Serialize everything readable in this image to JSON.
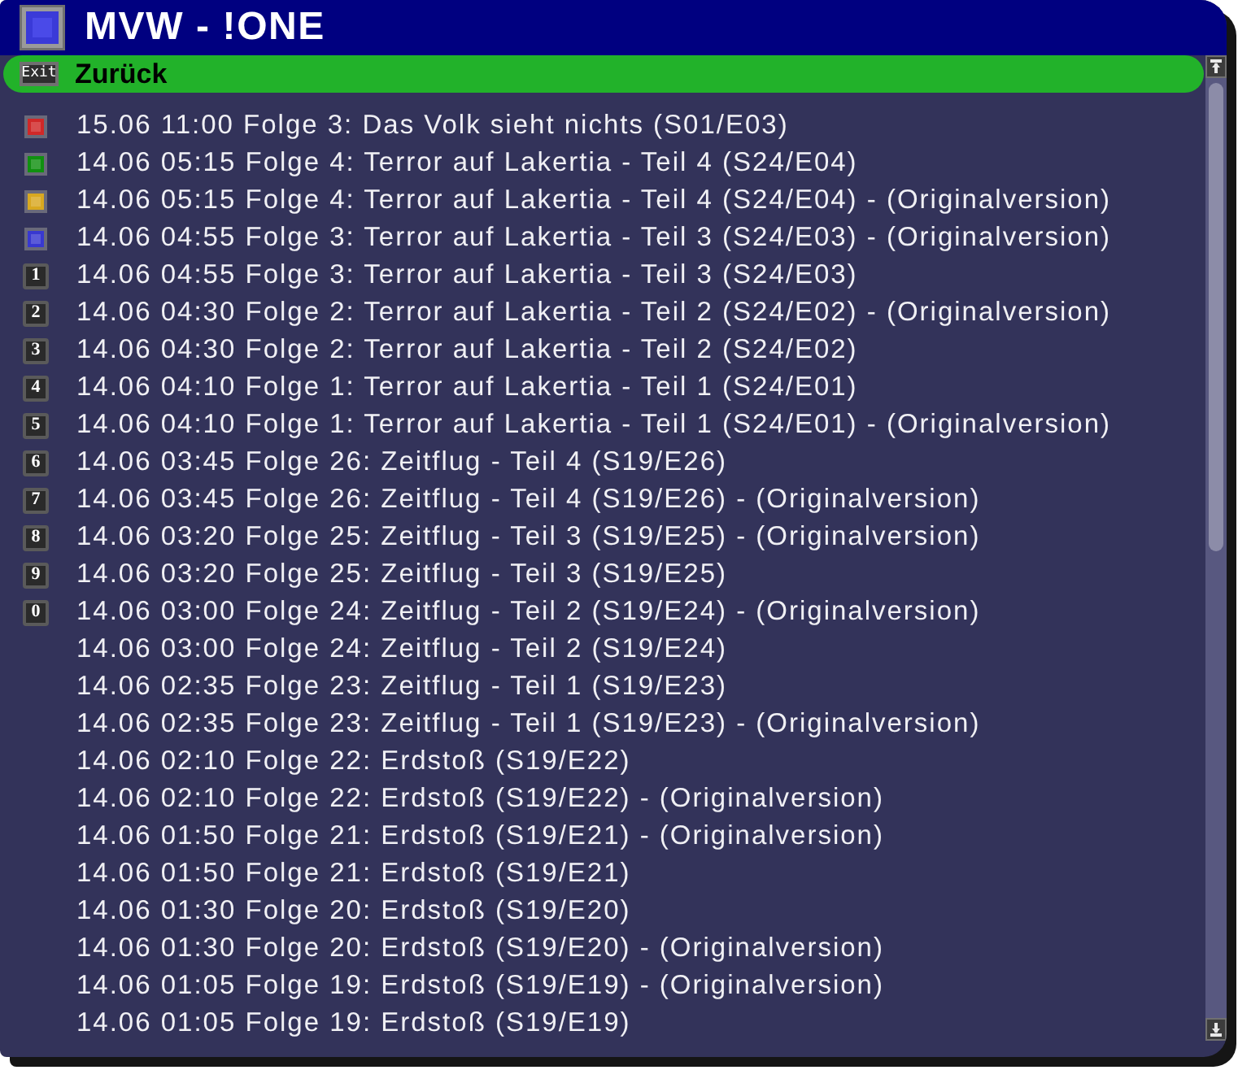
{
  "window": {
    "title": "MVW - !ONE"
  },
  "back_bar": {
    "key_label": "Exit",
    "label": "Zurück"
  },
  "items": [
    {
      "key": {
        "kind": "color",
        "color": "#d02828"
      },
      "text": "15.06 11:00 Folge 3: Das Volk sieht nichts (S01/E03)"
    },
    {
      "key": {
        "kind": "color",
        "color": "#109010"
      },
      "text": "14.06 05:15 Folge 4: Terror auf Lakertia - Teil 4 (S24/E04)"
    },
    {
      "key": {
        "kind": "color",
        "color": "#d8a820"
      },
      "text": "14.06 05:15 Folge 4: Terror auf Lakertia - Teil 4 (S24/E04) - (Originalversion)"
    },
    {
      "key": {
        "kind": "color",
        "color": "#3838d0"
      },
      "text": "14.06 04:55 Folge 3: Terror auf Lakertia - Teil 3 (S24/E03) - (Originalversion)"
    },
    {
      "key": {
        "kind": "number",
        "label": "1"
      },
      "text": "14.06 04:55 Folge 3: Terror auf Lakertia - Teil 3 (S24/E03)"
    },
    {
      "key": {
        "kind": "number",
        "label": "2"
      },
      "text": "14.06 04:30 Folge 2: Terror auf Lakertia - Teil 2 (S24/E02) - (Originalversion)"
    },
    {
      "key": {
        "kind": "number",
        "label": "3"
      },
      "text": "14.06 04:30 Folge 2: Terror auf Lakertia - Teil 2 (S24/E02)"
    },
    {
      "key": {
        "kind": "number",
        "label": "4"
      },
      "text": "14.06 04:10 Folge 1: Terror auf Lakertia - Teil 1 (S24/E01)"
    },
    {
      "key": {
        "kind": "number",
        "label": "5"
      },
      "text": "14.06 04:10 Folge 1: Terror auf Lakertia - Teil 1 (S24/E01) - (Originalversion)"
    },
    {
      "key": {
        "kind": "number",
        "label": "6"
      },
      "text": "14.06 03:45 Folge 26: Zeitflug - Teil 4 (S19/E26)"
    },
    {
      "key": {
        "kind": "number",
        "label": "7"
      },
      "text": "14.06 03:45 Folge 26: Zeitflug - Teil 4 (S19/E26) - (Originalversion)"
    },
    {
      "key": {
        "kind": "number",
        "label": "8"
      },
      "text": "14.06 03:20 Folge 25: Zeitflug - Teil 3 (S19/E25) - (Originalversion)"
    },
    {
      "key": {
        "kind": "number",
        "label": "9"
      },
      "text": "14.06 03:20 Folge 25: Zeitflug - Teil 3 (S19/E25)"
    },
    {
      "key": {
        "kind": "number",
        "label": "0"
      },
      "text": "14.06 03:00 Folge 24: Zeitflug - Teil 2 (S19/E24) - (Originalversion)"
    },
    {
      "text": "14.06 03:00 Folge 24: Zeitflug - Teil 2 (S19/E24)"
    },
    {
      "text": "14.06 02:35 Folge 23: Zeitflug - Teil 1 (S19/E23)"
    },
    {
      "text": "14.06 02:35 Folge 23: Zeitflug - Teil 1 (S19/E23) - (Originalversion)"
    },
    {
      "text": "14.06 02:10 Folge 22: Erdstoß (S19/E22)"
    },
    {
      "text": "14.06 02:10 Folge 22: Erdstoß (S19/E22) - (Originalversion)"
    },
    {
      "text": "14.06 01:50 Folge 21: Erdstoß (S19/E21) - (Originalversion)"
    },
    {
      "text": "14.06 01:50 Folge 21: Erdstoß (S19/E21)"
    },
    {
      "text": "14.06 01:30 Folge 20: Erdstoß (S19/E20)"
    },
    {
      "text": "14.06 01:30 Folge 20: Erdstoß (S19/E20) - (Originalversion)"
    },
    {
      "text": "14.06 01:05 Folge 19: Erdstoß (S19/E19) - (Originalversion)"
    },
    {
      "text": "14.06 01:05 Folge 19: Erdstoß (S19/E19)"
    }
  ]
}
